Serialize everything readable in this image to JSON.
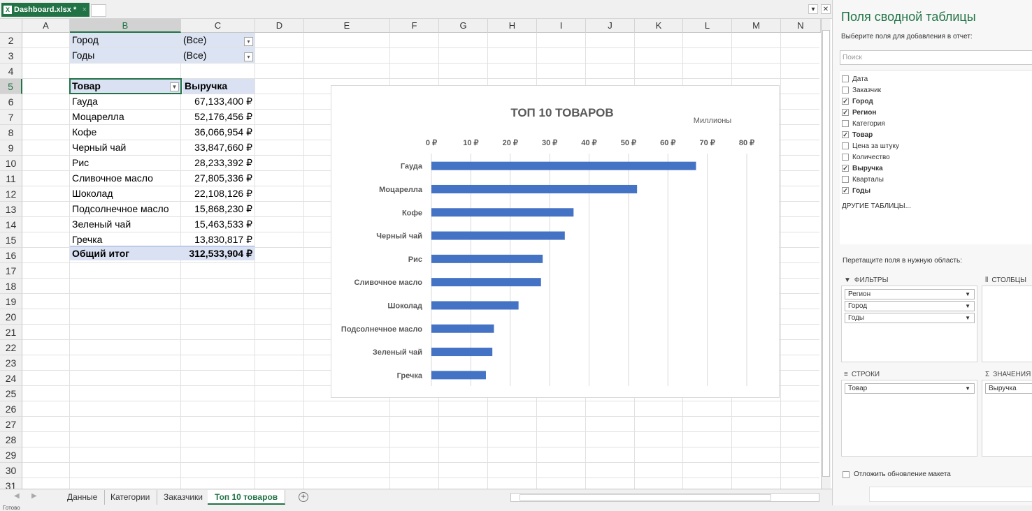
{
  "window": {
    "file_tab": "Dashboard.xlsx *",
    "close_glyph": "×"
  },
  "columns": [
    "A",
    "B",
    "C",
    "D",
    "E",
    "F",
    "G",
    "H",
    "I",
    "J",
    "K",
    "L",
    "M",
    "N"
  ],
  "rows": [
    "2",
    "3",
    "4",
    "5",
    "6",
    "7",
    "8",
    "9",
    "10",
    "11",
    "12",
    "13",
    "14",
    "15",
    "16",
    "17",
    "18",
    "19",
    "20",
    "21",
    "22",
    "23",
    "24",
    "25",
    "26",
    "27",
    "28",
    "29",
    "30",
    "31"
  ],
  "pivot": {
    "filters": [
      {
        "label": "Город",
        "value": "(Все)"
      },
      {
        "label": "Годы",
        "value": "(Все)"
      }
    ],
    "header": {
      "product": "Товар",
      "revenue": "Выручка"
    },
    "items": [
      {
        "product": "Гауда",
        "revenue": "67,133,400 ₽"
      },
      {
        "product": "Моцарелла",
        "revenue": "52,176,456 ₽"
      },
      {
        "product": "Кофе",
        "revenue": "36,066,954 ₽"
      },
      {
        "product": "Черный чай",
        "revenue": "33,847,660 ₽"
      },
      {
        "product": "Рис",
        "revenue": "28,233,392 ₽"
      },
      {
        "product": "Сливочное масло",
        "revenue": "27,805,336 ₽"
      },
      {
        "product": "Шоколад",
        "revenue": "22,108,126 ₽"
      },
      {
        "product": "Подсолнечное масло",
        "revenue": "15,868,230 ₽"
      },
      {
        "product": "Зеленый чай",
        "revenue": "15,463,533 ₽"
      },
      {
        "product": "Гречка",
        "revenue": "13,830,817 ₽"
      }
    ],
    "total": {
      "label": "Общий итог",
      "value": "312,533,904 ₽"
    }
  },
  "chart_data": {
    "type": "bar",
    "orientation": "horizontal",
    "title": "ТОП 10 ТОВАРОВ",
    "units_label": "Миллионы",
    "categories": [
      "Гауда",
      "Моцарелла",
      "Кофе",
      "Черный чай",
      "Рис",
      "Сливочное масло",
      "Шоколад",
      "Подсолнечное масло",
      "Зеленый чай",
      "Гречка"
    ],
    "values": [
      67.1334,
      52.176456,
      36.066954,
      33.84766,
      28.233392,
      27.805336,
      22.108126,
      15.86823,
      15.463533,
      13.830817
    ],
    "xlim": [
      0,
      80
    ],
    "ticks": [
      "0 ₽",
      "10 ₽",
      "20 ₽",
      "30 ₽",
      "40 ₽",
      "50 ₽",
      "60 ₽",
      "70 ₽",
      "80 ₽"
    ],
    "tick_values": [
      0,
      10,
      20,
      30,
      40,
      50,
      60,
      70,
      80
    ],
    "axis_position": "top",
    "grid": true,
    "bar_color": "#4472C4"
  },
  "sheet_tabs": [
    "Данные",
    "Категории",
    "Заказчики",
    "Топ 10 товаров"
  ],
  "active_sheet": "Топ 10 товаров",
  "add_sheet_glyph": "+",
  "status": {
    "ready": "Готово"
  },
  "pane": {
    "title": "Поля сводной таблицы",
    "subtitle": "Выберите поля для добавления в отчет:",
    "search_placeholder": "Поиск",
    "fields": [
      {
        "name": "Дата",
        "checked": false
      },
      {
        "name": "Заказчик",
        "checked": false
      },
      {
        "name": "Город",
        "checked": true
      },
      {
        "name": "Регион",
        "checked": true
      },
      {
        "name": "Категория",
        "checked": false
      },
      {
        "name": "Товар",
        "checked": true
      },
      {
        "name": "Цена за штуку",
        "checked": false
      },
      {
        "name": "Количество",
        "checked": false
      },
      {
        "name": "Выручка",
        "checked": true
      },
      {
        "name": "Кварталы",
        "checked": false
      },
      {
        "name": "Годы",
        "checked": true
      }
    ],
    "more_tables": "ДРУГИЕ ТАБЛИЦЫ...",
    "drag_hint": "Перетащите поля в нужную область:",
    "filters_label": "ФИЛЬТРЫ",
    "columns_label": "СТОЛБЦЫ",
    "rows_label": "СТРОКИ",
    "values_label": "ЗНАЧЕНИЯ",
    "filter_items": [
      "Регион",
      "Город",
      "Годы"
    ],
    "row_items": [
      "Товар"
    ],
    "value_items": [
      "Выручка"
    ],
    "defer_label": "Отложить обновление макета"
  }
}
